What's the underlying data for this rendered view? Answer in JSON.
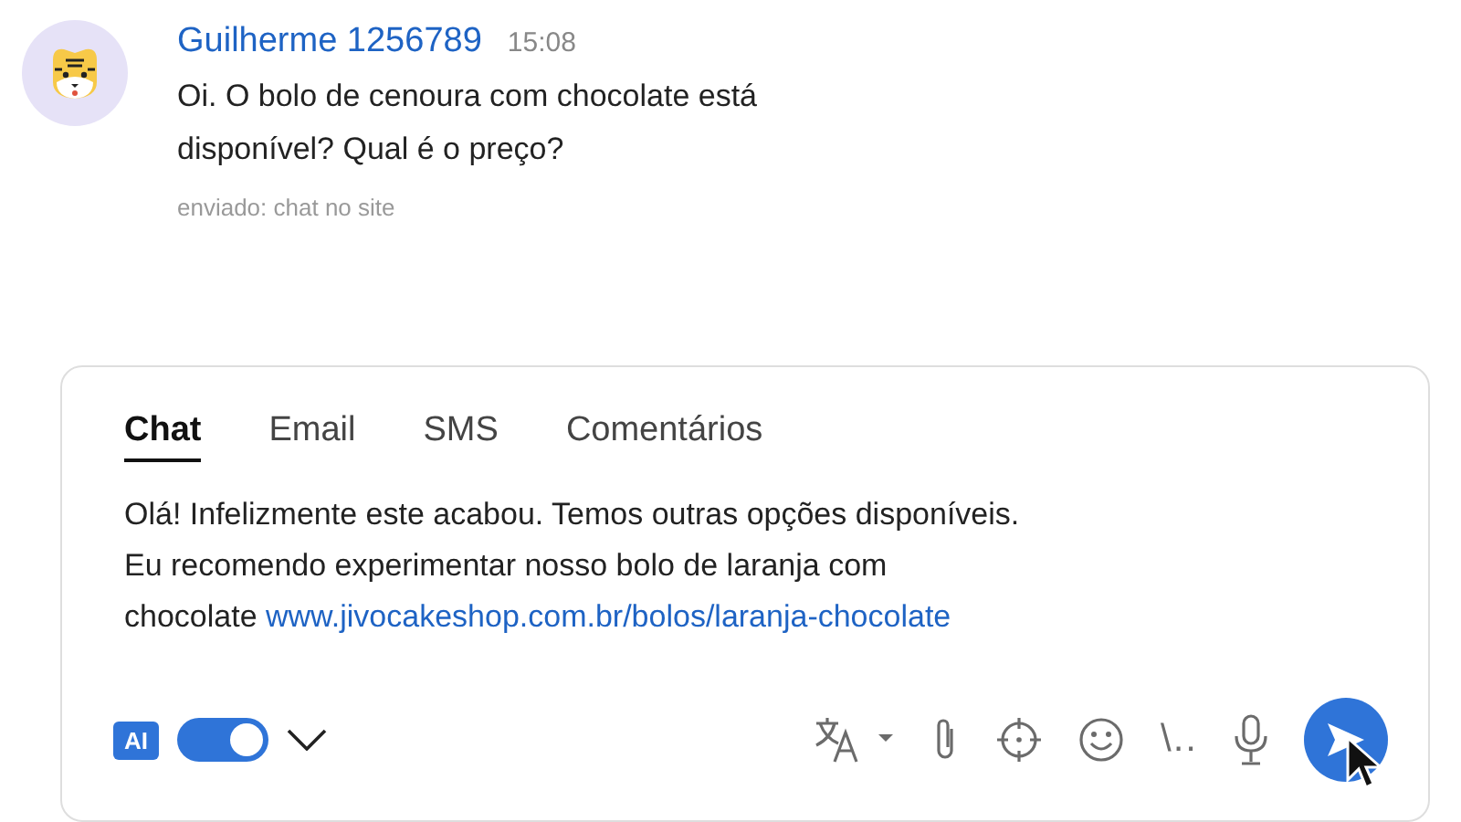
{
  "message": {
    "author": "Guilherme 1256789",
    "time": "15:08",
    "text": "Oi. O bolo de cenoura com chocolate está\ndisponível? Qual é o preço?",
    "source": "enviado: chat no site"
  },
  "composer": {
    "tabs": [
      {
        "label": "Chat",
        "selected": true
      },
      {
        "label": "Email",
        "selected": false
      },
      {
        "label": "SMS",
        "selected": false
      },
      {
        "label": "Comentários",
        "selected": false
      }
    ],
    "reply_text": "Olá! Infelizmente este acabou. Temos outras opções disponíveis.\nEu recomendo experimentar nosso bolo de laranja com\nchocolate ",
    "reply_link": "www.jivocakeshop.com.br/bolos/laranja-chocolate",
    "ai_badge": "AI",
    "ai_toggle": {
      "on": true
    },
    "shortcut_glyph": "\\.."
  }
}
